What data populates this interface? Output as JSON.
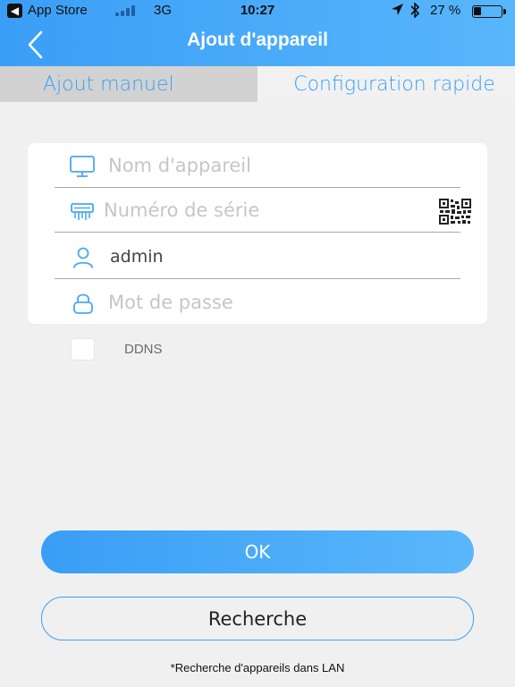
{
  "status_bar": {
    "back_app_label": "App Store",
    "network": "3G",
    "time": "10:27",
    "battery_percent_label": "27 %",
    "battery_level": 0.27,
    "back_app_glyph": "◀"
  },
  "nav": {
    "title": "Ajout d'appareil",
    "back_icon": "chevron-left-icon"
  },
  "tabs": [
    {
      "label": "Ajout manuel",
      "selected": true
    },
    {
      "label": "Configuration rapide",
      "selected": false
    }
  ],
  "form": {
    "device_name": {
      "placeholder": "Nom d'appareil",
      "value": "",
      "icon": "monitor-icon"
    },
    "serial_number": {
      "placeholder": "Numéro de série",
      "value": "",
      "icon": "device-icon",
      "scan_icon": "qr-code-icon"
    },
    "username": {
      "placeholder": "",
      "value": "admin",
      "icon": "user-icon"
    },
    "password": {
      "placeholder": "Mot de passe",
      "value": "",
      "icon": "lock-icon"
    }
  },
  "ddns": {
    "label": "DDNS",
    "checked": false
  },
  "buttons": {
    "ok": "OK",
    "search": "Recherche"
  },
  "footnote": "*Recherche d'appareils dans LAN",
  "colors": {
    "accent": "#3a9ef6",
    "accent_light": "#58b6fb",
    "tab_text": "#3aa0f3",
    "background": "#f0f0f0"
  }
}
